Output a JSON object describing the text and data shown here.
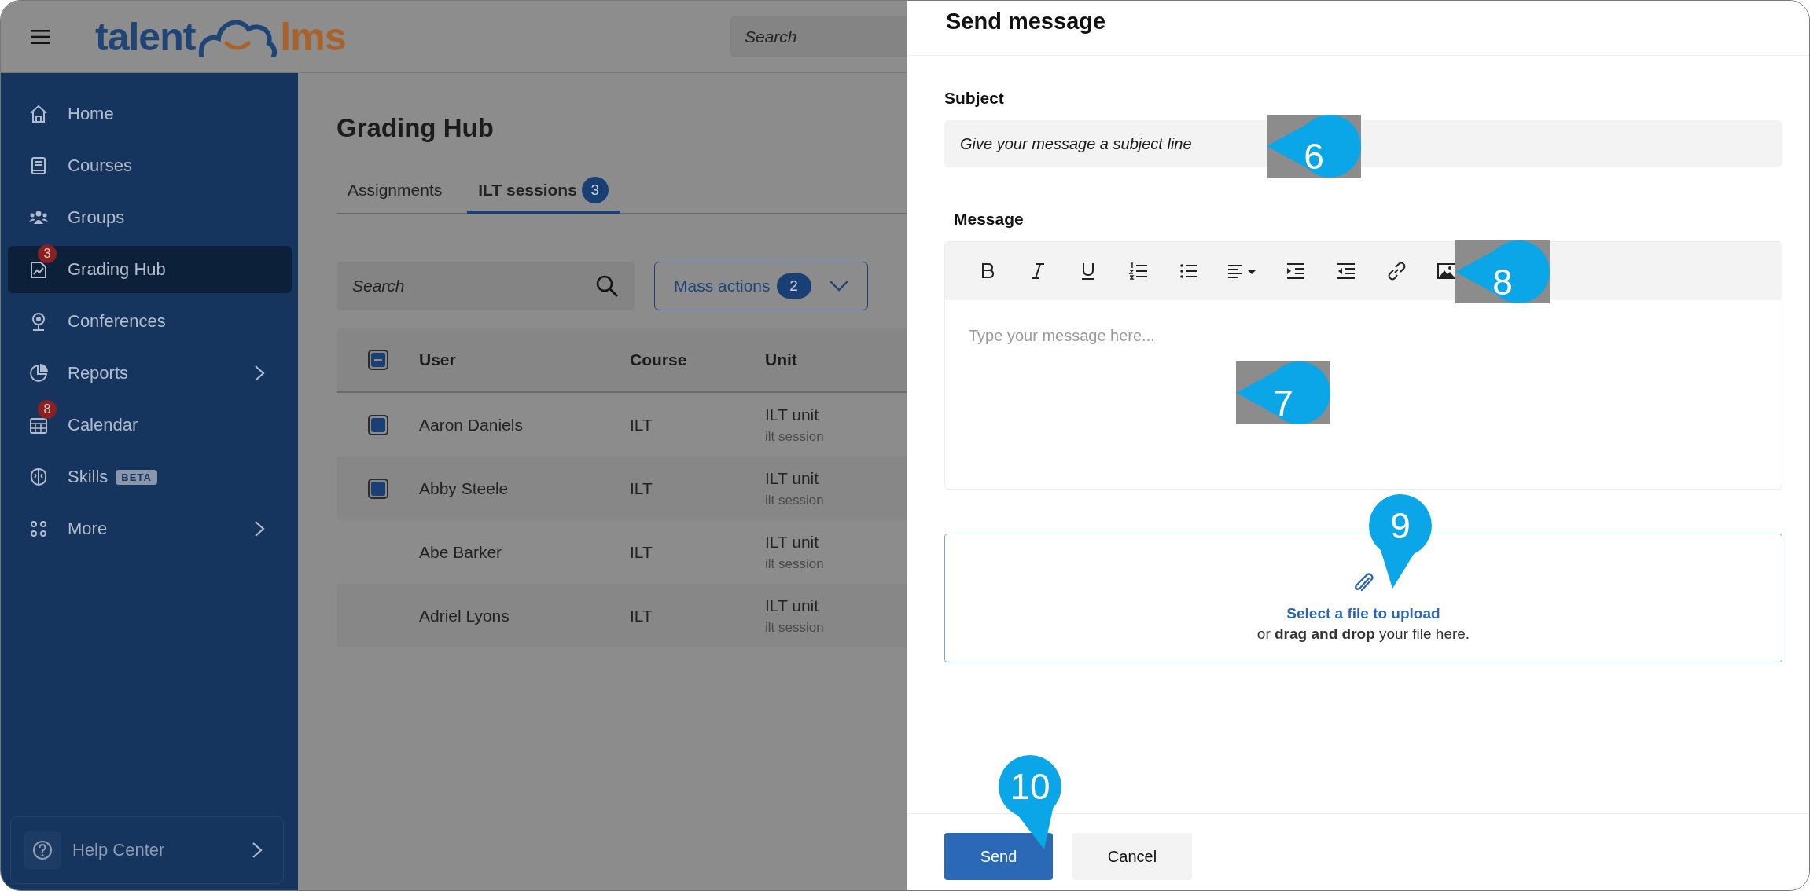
{
  "topbar": {
    "logo": {
      "left": "talent",
      "right": "lms"
    },
    "search": {
      "placeholder": "Search"
    }
  },
  "sidebar": {
    "items": [
      {
        "label": "Home",
        "selected": false
      },
      {
        "label": "Courses",
        "selected": false
      },
      {
        "label": "Groups",
        "selected": false
      },
      {
        "label": "Grading Hub",
        "selected": true,
        "badge": "3"
      },
      {
        "label": "Conferences",
        "selected": false
      },
      {
        "label": "Reports",
        "selected": false,
        "submenu": true
      },
      {
        "label": "Calendar",
        "selected": false,
        "badge": "8"
      },
      {
        "label": "Skills",
        "selected": false,
        "tag": "BETA"
      },
      {
        "label": "More",
        "selected": false,
        "submenu": true
      }
    ],
    "help": {
      "label": "Help Center"
    }
  },
  "page": {
    "title": "Grading Hub",
    "tabs": [
      {
        "label": "Assignments",
        "selected": false
      },
      {
        "label": "ILT sessions",
        "selected": true,
        "count": "3"
      }
    ],
    "search": {
      "placeholder": "Search"
    },
    "mass_actions": {
      "label": "Mass actions",
      "count": "2"
    },
    "table": {
      "columns": [
        "User",
        "Course",
        "Unit"
      ],
      "select_all_partial": true,
      "rows": [
        {
          "user": "Aaron Daniels",
          "course": "ILT",
          "unit": "ILT unit",
          "unit_detail": "ilt session",
          "checked": true
        },
        {
          "user": "Abby Steele",
          "course": "ILT",
          "unit": "ILT unit",
          "unit_detail": "ilt session",
          "checked": true
        },
        {
          "user": "Abe Barker",
          "course": "ILT",
          "unit": "ILT unit",
          "unit_detail": "ilt session",
          "checked": false
        },
        {
          "user": "Adriel Lyons",
          "course": "ILT",
          "unit": "ILT unit",
          "unit_detail": "ilt session",
          "checked": false
        }
      ]
    }
  },
  "panel": {
    "title": "Send message",
    "subject": {
      "label": "Subject",
      "placeholder": "Give your message a subject line"
    },
    "message": {
      "label": "Message",
      "placeholder": "Type your message here...",
      "toolbar": {
        "buttons": [
          {
            "kind": "bold"
          },
          {
            "kind": "italic"
          },
          {
            "kind": "underline"
          },
          {
            "kind": "ordered-list"
          },
          {
            "kind": "bullet-list"
          },
          {
            "kind": "align"
          },
          {
            "kind": "indent"
          },
          {
            "kind": "outdent"
          },
          {
            "kind": "link"
          },
          {
            "kind": "image"
          }
        ]
      }
    },
    "upload": {
      "link": "Select a file to upload",
      "hint": "or **drag and drop** your file here."
    },
    "buttons": [
      {
        "label": "Send",
        "kind": "primary"
      },
      {
        "label": "Cancel",
        "kind": "secondary"
      }
    ],
    "callouts": [
      {
        "number": "6",
        "kind": "left"
      },
      {
        "number": "7",
        "kind": "left"
      },
      {
        "number": "8",
        "kind": "left"
      },
      {
        "number": "9",
        "kind": "down"
      },
      {
        "number": "10",
        "kind": "down"
      }
    ]
  }
}
